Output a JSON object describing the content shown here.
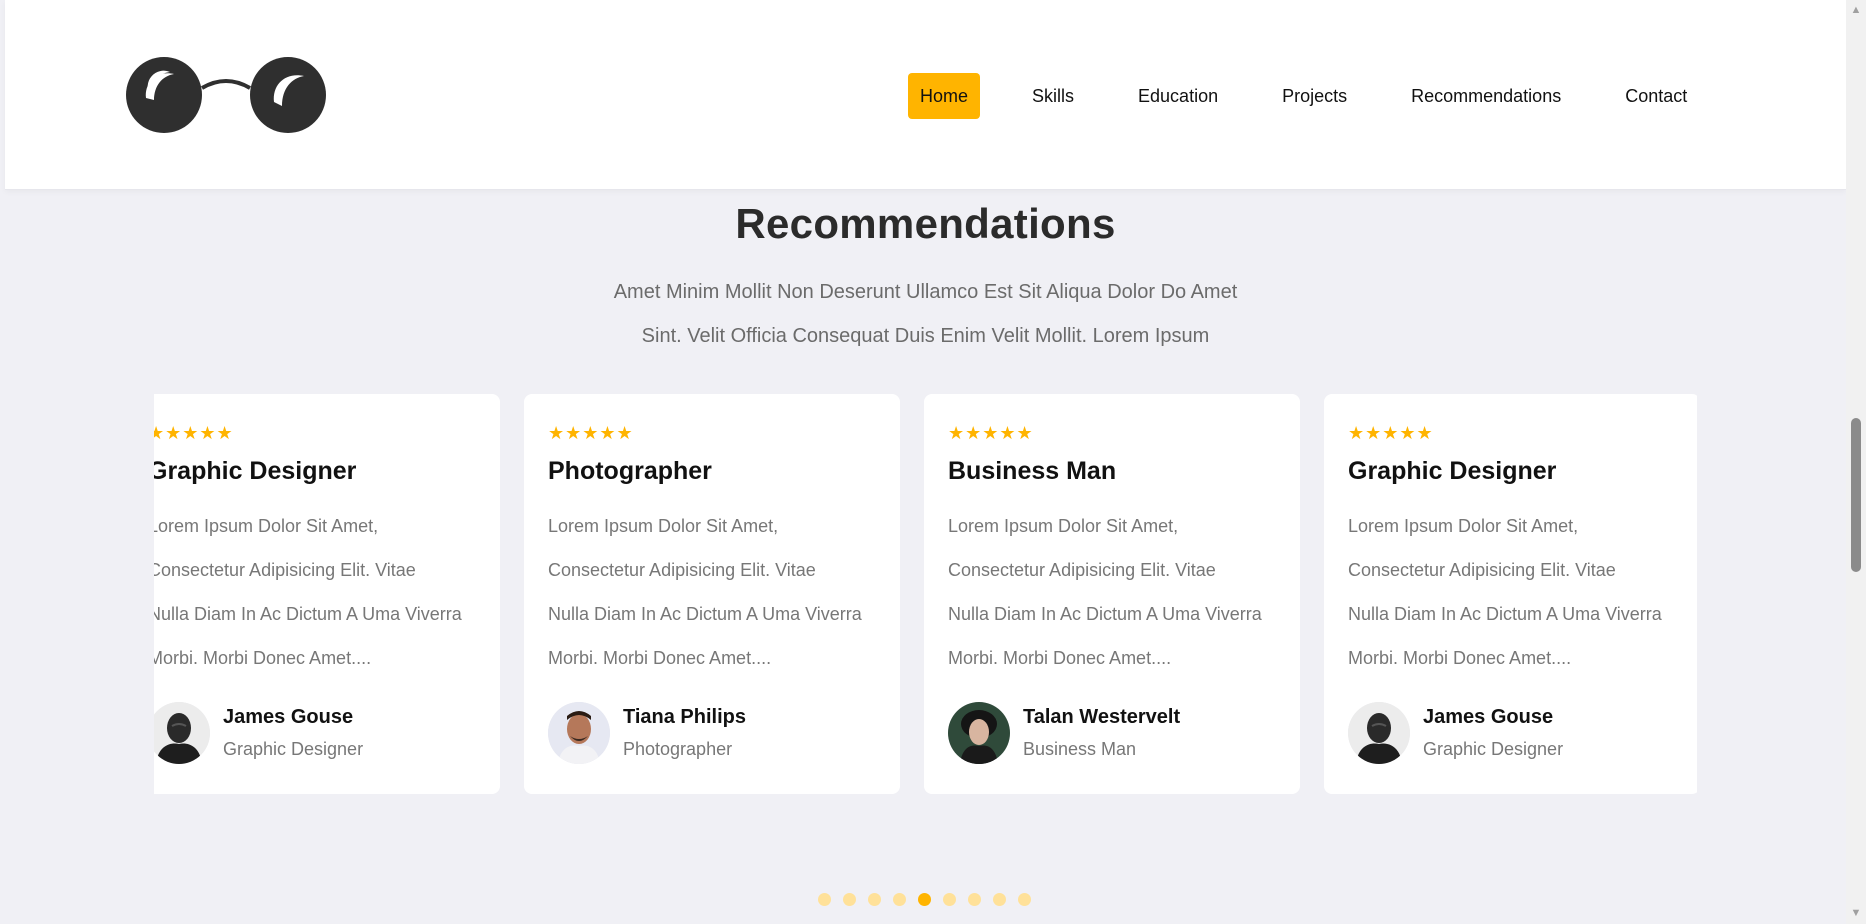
{
  "nav": {
    "items": [
      "Home",
      "Skills",
      "Education",
      "Projects",
      "Recommendations",
      "Contact"
    ],
    "active": "Home"
  },
  "section": {
    "title": "Recommendations",
    "subtitle_line1": "Amet Minim Mollit Non Deserunt Ullamco Est Sit Aliqua Dolor Do Amet",
    "subtitle_line2": "Sint. Velit Officia Consequat Duis Enim Velit Mollit. Lorem Ipsum"
  },
  "cards": [
    {
      "stars": "★★★★★",
      "title": "Graphic Designer",
      "text": [
        "Lorem Ipsum Dolor Sit Amet,",
        "Consectetur Adipisicing Elit. Vitae",
        "Nulla Diam In Ac Dictum A Uma Viverra",
        "Morbi. Morbi Donec Amet...."
      ],
      "author": "James Gouse",
      "role": "Graphic Designer",
      "avatar": "man-portrait-bw"
    },
    {
      "stars": "★★★★★",
      "title": "Photographer",
      "text": [
        "Lorem Ipsum Dolor Sit Amet,",
        "Consectetur Adipisicing Elit. Vitae",
        "Nulla Diam In Ac Dictum A Uma Viverra",
        "Morbi. Morbi Donec Amet...."
      ],
      "author": "Tiana Philips",
      "role": "Photographer",
      "avatar": "man-portrait-color"
    },
    {
      "stars": "★★★★★",
      "title": "Business Man",
      "text": [
        "Lorem Ipsum Dolor Sit Amet,",
        "Consectetur Adipisicing Elit. Vitae",
        "Nulla Diam In Ac Dictum A Uma Viverra",
        "Morbi. Morbi Donec Amet...."
      ],
      "author": "Talan Westervelt",
      "role": "Business Man",
      "avatar": "woman-portrait-green"
    },
    {
      "stars": "★★★★★",
      "title": "Graphic Designer",
      "text": [
        "Lorem Ipsum Dolor Sit Amet,",
        "Consectetur Adipisicing Elit. Vitae",
        "Nulla Diam In Ac Dictum A Uma Viverra",
        "Morbi. Morbi Donec Amet...."
      ],
      "author": "James Gouse",
      "role": "Graphic Designer",
      "avatar": "man-portrait-bw"
    }
  ],
  "pagination": {
    "count": 9,
    "active_index": 4
  },
  "colors": {
    "accent": "#ffb400",
    "accent_light": "#ffe199",
    "background": "#f0f0f5",
    "text_muted": "#777777"
  }
}
